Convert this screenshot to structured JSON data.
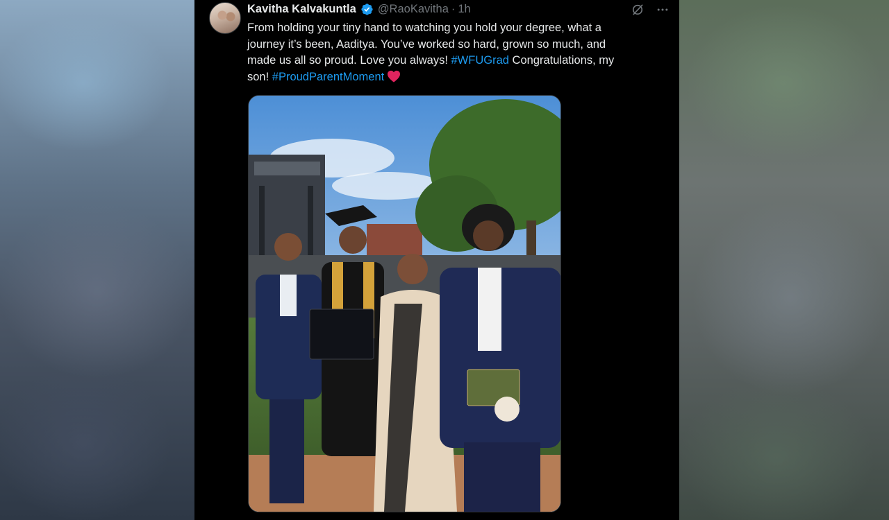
{
  "tweet": {
    "author_name": "Kavitha Kalvakuntla",
    "handle": "@RaoKavitha",
    "separator": "·",
    "time": "1h",
    "text": {
      "line1": "From holding your tiny hand to watching you hold your degree, what a",
      "line2": "journey it’s been, Aaditya. You’ve worked so hard, grown so much, and",
      "line3_a": "made us all so proud. Love you always! ",
      "hashtag1": "#WFUGrad",
      "line3_b": " Congratulations, my",
      "line4_a": "son! ",
      "hashtag2": "#ProudParentMoment"
    }
  },
  "icons": {
    "avatar": "profile-photo",
    "verified": "verified-badge-icon",
    "grok": "grok-icon",
    "more": "more-options-icon",
    "heart": "red-heart-emoji"
  },
  "colors": {
    "background": "#000000",
    "text": "#e7e9ea",
    "muted": "#71767b",
    "link": "#1d9bf0",
    "verified": "#1d9bf0",
    "heart": "#e0245e"
  }
}
